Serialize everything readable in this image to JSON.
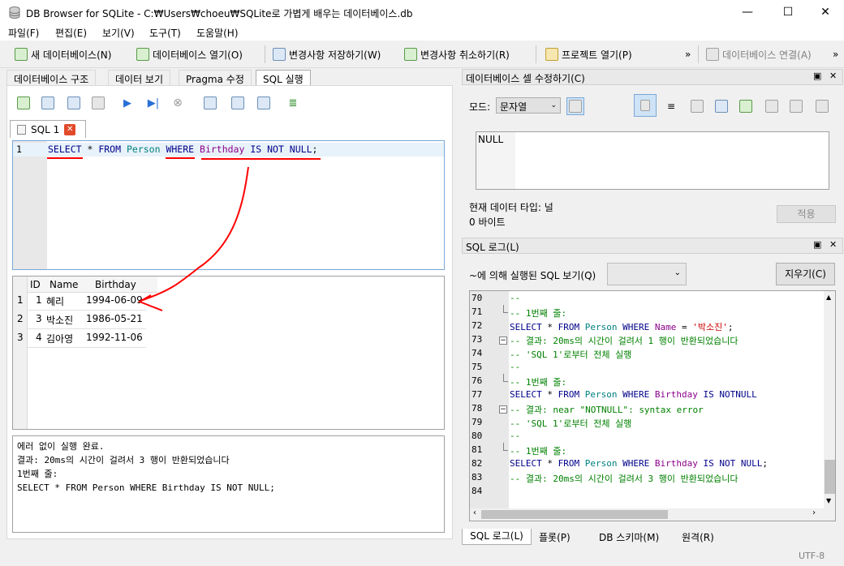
{
  "window": {
    "title": "DB Browser for SQLite - C:₩Users₩choeu₩SQLite로 가볍게 배우는 데이터베이스.db",
    "minimize": "—",
    "maximize": "☐",
    "close": "✕"
  },
  "menu": [
    "파일(F)",
    "편집(E)",
    "보기(V)",
    "도구(T)",
    "도움말(H)"
  ],
  "toolbar": {
    "new_db": "새 데이터베이스(N)",
    "open_db": "데이터베이스 열기(O)",
    "write_changes": "변경사항 저장하기(W)",
    "revert_changes": "변경사항 취소하기(R)",
    "open_project": "프로젝트 열기(P)",
    "attach_db": "데이터베이스 연결(A)",
    "overflow": "»"
  },
  "main_tabs": [
    "데이터베이스 구조",
    "데이터 보기",
    "Pragma 수정",
    "SQL 실행"
  ],
  "editor": {
    "tab_label": "SQL 1",
    "line_number": "1",
    "query_tokens": [
      {
        "t": "SELECT",
        "c": "kw"
      },
      {
        "t": " * ",
        "c": ""
      },
      {
        "t": "FROM",
        "c": "kw"
      },
      {
        "t": " ",
        "c": ""
      },
      {
        "t": "Person",
        "c": "tbl"
      },
      {
        "t": " ",
        "c": ""
      },
      {
        "t": "WHERE",
        "c": "kw"
      },
      {
        "t": " ",
        "c": ""
      },
      {
        "t": "Birthday",
        "c": "col"
      },
      {
        "t": " ",
        "c": ""
      },
      {
        "t": "IS NOT NULL",
        "c": "kw"
      },
      {
        "t": ";",
        "c": ""
      }
    ]
  },
  "results": {
    "columns": [
      "ID",
      "Name",
      "Birthday"
    ],
    "rows": [
      {
        "num": "1",
        "id": "1",
        "name": "혜리",
        "birthday": "1994-06-09"
      },
      {
        "num": "2",
        "id": "3",
        "name": "박소진",
        "birthday": "1986-05-21"
      },
      {
        "num": "3",
        "id": "4",
        "name": "김아영",
        "birthday": "1992-11-06"
      }
    ]
  },
  "message": [
    "에러 없이 실행 완료.",
    "결과: 20ms의 시간이 걸려서 3 행이 반환되었습니다",
    "1번째 줄:",
    "SELECT * FROM Person WHERE Birthday IS NOT NULL;"
  ],
  "cell_editor": {
    "title": "데이터베이스 셀 수정하기(C)",
    "mode_label": "모드:",
    "mode_value": "문자열",
    "value": "NULL",
    "type_label": "현재 데이터 타입: 널",
    "size_label": "0 바이트",
    "apply": "적용"
  },
  "sql_log": {
    "title": "SQL 로그(L)",
    "filter_label": "~에 의해 실행된 SQL 보기(Q)",
    "clear": "지우기(C)",
    "lines": [
      {
        "n": "70",
        "fold": "",
        "tokens": [
          {
            "t": "--",
            "c": "cm"
          }
        ]
      },
      {
        "n": "71",
        "fold": "end",
        "tokens": [
          {
            "t": "-- 1번째 줄:",
            "c": "cm"
          }
        ]
      },
      {
        "n": "72",
        "fold": "",
        "tokens": [
          {
            "t": "SELECT",
            "c": "kw"
          },
          {
            "t": " * ",
            "c": ""
          },
          {
            "t": "FROM",
            "c": "kw"
          },
          {
            "t": " ",
            "c": ""
          },
          {
            "t": "Person",
            "c": "tbl"
          },
          {
            "t": " ",
            "c": ""
          },
          {
            "t": "WHERE",
            "c": "kw"
          },
          {
            "t": " ",
            "c": ""
          },
          {
            "t": "Name",
            "c": "col"
          },
          {
            "t": " = ",
            "c": ""
          },
          {
            "t": "'박소진'",
            "c": "str"
          },
          {
            "t": ";",
            "c": ""
          }
        ]
      },
      {
        "n": "73",
        "fold": "box",
        "tokens": [
          {
            "t": "-- 결과: 20ms의 시간이 걸려서 1 행이 반환되었습니다",
            "c": "cm"
          }
        ]
      },
      {
        "n": "74",
        "fold": "",
        "tokens": [
          {
            "t": "-- 'SQL 1'로부터 전체 실행",
            "c": "cm"
          }
        ]
      },
      {
        "n": "75",
        "fold": "",
        "tokens": [
          {
            "t": "--",
            "c": "cm"
          }
        ]
      },
      {
        "n": "76",
        "fold": "end",
        "tokens": [
          {
            "t": "-- 1번째 줄:",
            "c": "cm"
          }
        ]
      },
      {
        "n": "77",
        "fold": "",
        "tokens": [
          {
            "t": "SELECT",
            "c": "kw"
          },
          {
            "t": " * ",
            "c": ""
          },
          {
            "t": "FROM",
            "c": "kw"
          },
          {
            "t": " ",
            "c": ""
          },
          {
            "t": "Person",
            "c": "tbl"
          },
          {
            "t": " ",
            "c": ""
          },
          {
            "t": "WHERE",
            "c": "kw"
          },
          {
            "t": " ",
            "c": ""
          },
          {
            "t": "Birthday",
            "c": "col"
          },
          {
            "t": " ",
            "c": ""
          },
          {
            "t": "IS",
            "c": "kw"
          },
          {
            "t": " ",
            "c": ""
          },
          {
            "t": "NOTNULL",
            "c": "kw"
          }
        ]
      },
      {
        "n": "78",
        "fold": "box",
        "tokens": [
          {
            "t": "-- 결과: near \"NOTNULL\": syntax error",
            "c": "cm"
          }
        ]
      },
      {
        "n": "79",
        "fold": "",
        "tokens": [
          {
            "t": "-- 'SQL 1'로부터 전체 실행",
            "c": "cm"
          }
        ]
      },
      {
        "n": "80",
        "fold": "",
        "tokens": [
          {
            "t": "--",
            "c": "cm"
          }
        ]
      },
      {
        "n": "81",
        "fold": "end",
        "tokens": [
          {
            "t": "-- 1번째 줄:",
            "c": "cm"
          }
        ]
      },
      {
        "n": "82",
        "fold": "",
        "tokens": [
          {
            "t": "SELECT",
            "c": "kw"
          },
          {
            "t": " * ",
            "c": ""
          },
          {
            "t": "FROM",
            "c": "kw"
          },
          {
            "t": " ",
            "c": ""
          },
          {
            "t": "Person",
            "c": "tbl"
          },
          {
            "t": " ",
            "c": ""
          },
          {
            "t": "WHERE",
            "c": "kw"
          },
          {
            "t": " ",
            "c": ""
          },
          {
            "t": "Birthday",
            "c": "col"
          },
          {
            "t": " ",
            "c": ""
          },
          {
            "t": "IS NOT NULL",
            "c": "kw"
          },
          {
            "t": ";",
            "c": ""
          }
        ]
      },
      {
        "n": "83",
        "fold": "",
        "tokens": [
          {
            "t": "-- 결과: 20ms의 시간이 걸려서 3 행이 반환되었습니다",
            "c": "cm"
          }
        ]
      },
      {
        "n": "84",
        "fold": "",
        "tokens": []
      }
    ]
  },
  "bottom_tabs": [
    "SQL 로그(L)",
    "플롯(P)",
    "DB 스키마(M)",
    "원격(R)"
  ],
  "status": {
    "encoding": "UTF-8"
  },
  "colors": {
    "annotation": "#ff0000",
    "keyword": "#00008b",
    "comment": "#008000"
  }
}
